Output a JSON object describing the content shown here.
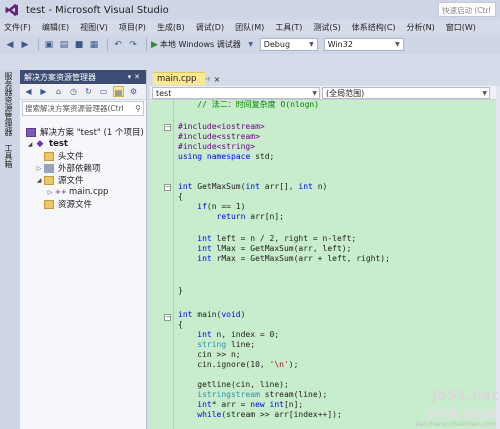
{
  "window": {
    "title": "test - Microsoft Visual Studio",
    "quick_launch_placeholder": "快速启动 (Ctrl"
  },
  "menu": [
    "文件(F)",
    "编辑(E)",
    "视图(V)",
    "项目(P)",
    "生成(B)",
    "调试(D)",
    "团队(M)",
    "工具(T)",
    "测试(S)",
    "体系结构(C)",
    "分析(N)",
    "窗口(W)"
  ],
  "toolbar": {
    "run_label": "本地 Windows 调试器",
    "config": "Debug",
    "platform": "Win32"
  },
  "left_strip": {
    "tab_a": "服务器资源管理器",
    "tab_b": "工具箱"
  },
  "solution_explorer": {
    "title": "解决方案资源管理器",
    "search_placeholder": "搜索解决方案资源管理器(Ctrl",
    "tree": {
      "solution": "解决方案 \"test\" (1 个项目)",
      "project": "test",
      "headers": "头文件",
      "external_deps": "外部依赖项",
      "source_files": "源文件",
      "main_file": "main.cpp",
      "resource_files": "资源文件"
    }
  },
  "editor": {
    "tab_label": "main.cpp",
    "nav_left": "test",
    "nav_mid": "(全局范围)",
    "lines": [
      "    // 法二：时间复杂度 O(nlogn)",
      "",
      "#include<iostream>",
      "#include<sstream>",
      "#include<string>",
      "using namespace std;",
      "",
      "",
      "int GetMaxSum(int arr[], int n)",
      "{",
      "    if(n == 1)",
      "        return arr[n];",
      "",
      "    int left = n / 2, right = n-left;",
      "    int lMax = GetMaxSum(arr, left);",
      "    int rMax = GetMaxSum(arr + left, right);",
      "",
      "",
      "}",
      "",
      "int main(void)",
      "{",
      "    int n, index = 0;",
      "    string line;",
      "    cin >> n;",
      "    cin.ignore(10, '\\n');",
      "",
      "    getline(cin, line);",
      "    istringstream stream(line);",
      "    int* arr = new int[n];",
      "    while(stream >> arr[index++]);"
    ]
  },
  "watermark": {
    "line1": "jb51.net",
    "line2": "查字典 教程网",
    "line3": "jiaocheng.chazidian.com"
  }
}
